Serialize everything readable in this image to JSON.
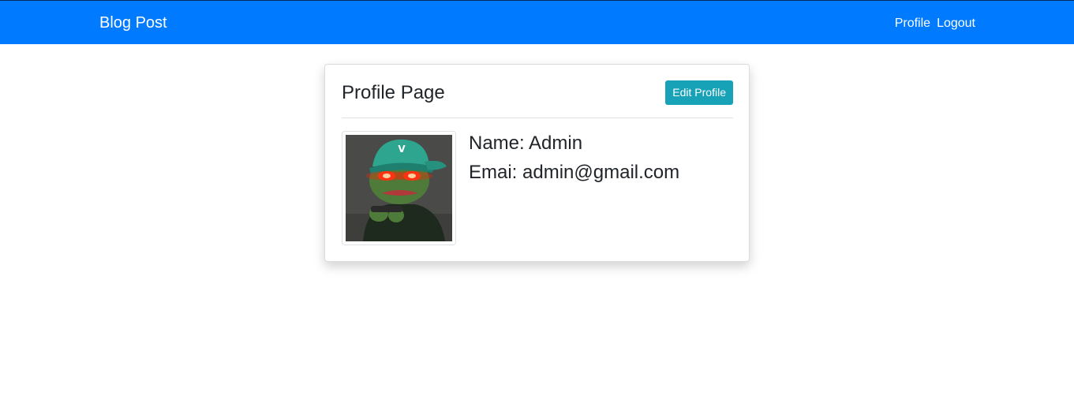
{
  "navbar": {
    "brand": "Blog Post",
    "links": [
      {
        "label": "Profile"
      },
      {
        "label": "Logout"
      }
    ],
    "background_color": "#007bff"
  },
  "card": {
    "title": "Profile Page",
    "edit_button_label": "Edit Profile",
    "edit_button_color": "#17a2b8",
    "avatar_icon": "pepe-frog-avatar",
    "fields": [
      {
        "label": "Name:",
        "value": "Admin"
      },
      {
        "label": "Emai:",
        "value": "admin@gmail.com"
      }
    ]
  }
}
